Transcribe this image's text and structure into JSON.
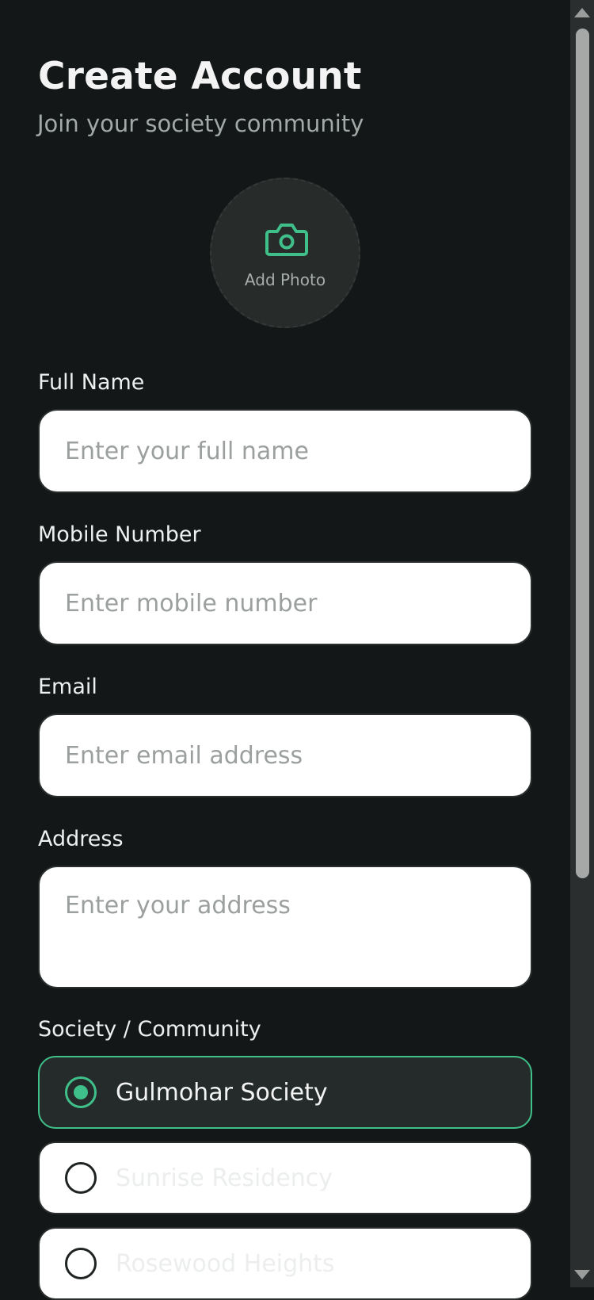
{
  "header": {
    "title": "Create Account",
    "subtitle": "Join your society community"
  },
  "photo": {
    "label": "Add Photo",
    "icon": "camera-icon"
  },
  "form": {
    "full_name": {
      "label": "Full Name",
      "placeholder": "Enter your full name",
      "value": ""
    },
    "mobile": {
      "label": "Mobile Number",
      "placeholder": "Enter mobile number",
      "value": ""
    },
    "email": {
      "label": "Email",
      "placeholder": "Enter email address",
      "value": ""
    },
    "address": {
      "label": "Address",
      "placeholder": "Enter your address",
      "value": ""
    }
  },
  "society": {
    "label": "Society / Community",
    "selected": "Gulmohar Society",
    "options": [
      {
        "label": "Gulmohar Society",
        "selected": true
      },
      {
        "label": "Sunrise Residency",
        "selected": false
      },
      {
        "label": "Rosewood Heights",
        "selected": false
      }
    ]
  },
  "colors": {
    "background": "#131717",
    "accent": "#3fbf8a",
    "input_background": "#ffffff",
    "placeholder": "#9ba09e"
  }
}
